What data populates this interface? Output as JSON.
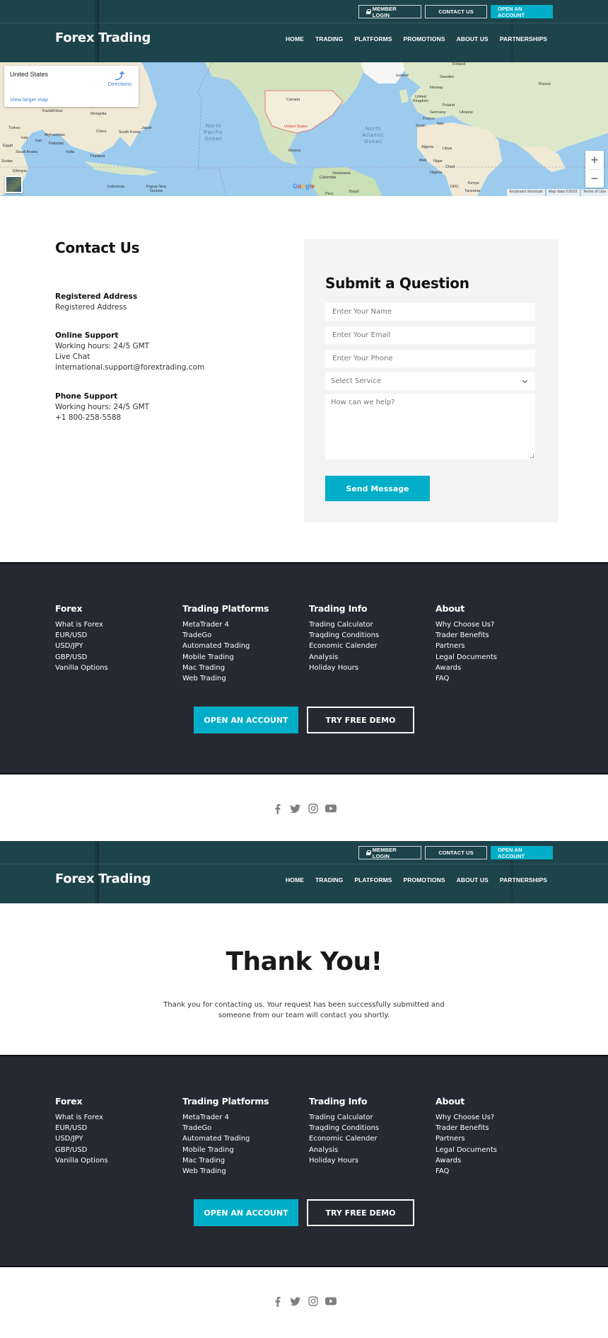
{
  "header": {
    "brand": "Forex Trading",
    "top_buttons": {
      "member_login": "MEMBER LOGIN",
      "contact_us": "CONTACT US",
      "open_account": "OPEN AN ACCOUNT"
    },
    "nav": [
      "HOME",
      "TRADING",
      "PLATFORMS",
      "PROMOTIONS",
      "ABOUT US",
      "PARTNERSHIPS"
    ]
  },
  "map": {
    "place_name": "United States",
    "directions_label": "Directions",
    "view_larger_label": "View larger map",
    "zoom_in": "+",
    "zoom_out": "−",
    "google_logo": "Google",
    "attribution": [
      "Keyboard shortcuts",
      "Map data ©2022",
      "Terms of Use"
    ],
    "labels": {
      "north_pacific": "North Pacific Ocean",
      "north_atlantic": "North Atlantic Ocean",
      "countries": [
        "Kazakhstan",
        "Mongolia",
        "China",
        "South Korea",
        "Japan",
        "Turkey",
        "Iraq",
        "Iran",
        "Afghanistan",
        "Pakistan",
        "India",
        "Egypt",
        "Saudi Arabia",
        "Sudan",
        "Ethiopia",
        "Thailand",
        "Indonesia",
        "Papua New Guinea",
        "Canada",
        "United States",
        "Mexico",
        "Iceland",
        "Sweden",
        "Norway",
        "United Kingdom",
        "Poland",
        "Germany",
        "France",
        "Ukraine",
        "Spain",
        "Italy",
        "Russia",
        "Algeria",
        "Libya",
        "Mali",
        "Niger",
        "Chad",
        "Nigeria",
        "Kenya",
        "DRC",
        "Tanzania",
        "Venezuela",
        "Colombia",
        "Brazil",
        "Peru",
        "Finland"
      ]
    }
  },
  "contact": {
    "title": "Contact Us",
    "registered": {
      "heading": "Registered Address",
      "lines": [
        "Registered Address"
      ]
    },
    "online": {
      "heading": "Online Support",
      "lines": [
        "Working hours: 24/5 GMT",
        "Live Chat",
        "international.support@forextrading.com"
      ]
    },
    "phone": {
      "heading": "Phone Support",
      "lines": [
        "Working hours: 24/5 GMT",
        "+1 800-258-5588"
      ]
    }
  },
  "form": {
    "title": "Submit a Question",
    "name_placeholder": "Enter Your Name",
    "email_placeholder": "Enter Your Email",
    "phone_placeholder": "Enter Your Phone",
    "service_selected": "Select Service",
    "message_placeholder": "How can we help?",
    "submit_label": "Send Message"
  },
  "footer": {
    "columns": [
      {
        "heading": "Forex",
        "links": [
          "What is Forex",
          "EUR/USD",
          "USD/JPY",
          "GBP/USD",
          "Vanilla Options"
        ]
      },
      {
        "heading": "Trading Platforms",
        "links": [
          "MetaTrader 4",
          "TradeGo",
          "Automated Trading",
          "Mobile Trading",
          "Mac Trading",
          "Web Trading"
        ]
      },
      {
        "heading": "Trading Info",
        "links": [
          "Trading Calculator",
          "Traqding Conditions",
          "Economic Calender",
          "Analysis",
          "Holiday Hours"
        ]
      },
      {
        "heading": "About",
        "links": [
          "Why Choose Us?",
          "Trader Benefits",
          "Partners",
          "Legal Documents",
          "Awards",
          "FAQ"
        ]
      }
    ],
    "open_account": "OPEN AN ACCOUNT",
    "try_demo": "TRY FREE DEMO"
  },
  "social": [
    "facebook-icon",
    "twitter-icon",
    "instagram-icon",
    "youtube-icon"
  ],
  "thank_you": {
    "title": "Thank You!",
    "message": "Thank you for contacting us. Your request has been successfully submitted and someone from our team will contact you shortly."
  },
  "colors": {
    "header_bg": "#1d434b",
    "accent": "#00aec7",
    "footer_bg": "#262931",
    "form_panel_bg": "#f4f4f4"
  }
}
